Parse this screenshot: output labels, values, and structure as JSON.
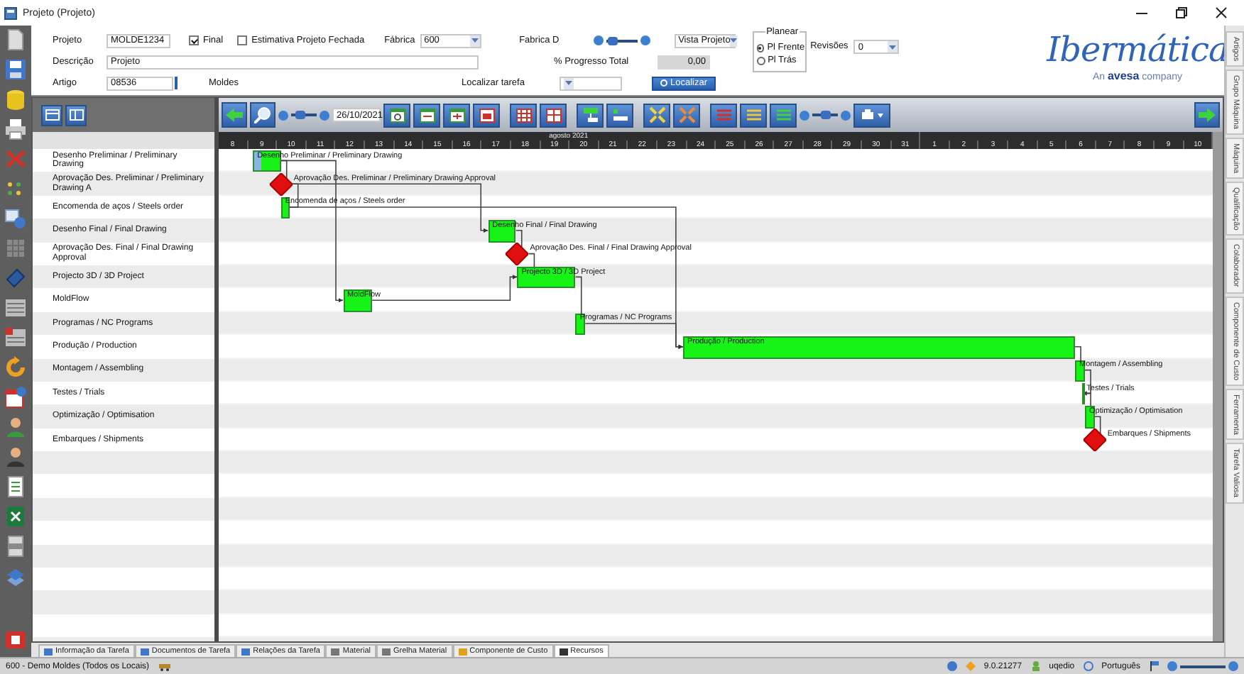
{
  "window": {
    "title": "Projeto (Projeto)"
  },
  "form": {
    "project": {
      "label": "Projeto",
      "value": "MOLDE1234"
    },
    "final": {
      "label": "Final",
      "checked": true
    },
    "estimate_closed": {
      "label": "Estimativa Projeto Fechada",
      "checked": false
    },
    "factory": {
      "label": "Fábrica",
      "value": "600"
    },
    "factory_name": "Fabrica D",
    "zoom": {
      "level": 0.2
    },
    "view": {
      "value": "Vista Projeto"
    },
    "plan": {
      "title": "Planear",
      "options": [
        {
          "label": "Pl Frente",
          "selected": true
        },
        {
          "label": "Pl Trás",
          "selected": false
        }
      ]
    },
    "revisions": {
      "label": "Revisões",
      "value": "0"
    },
    "description": {
      "label": "Descrição",
      "value": "Projeto"
    },
    "progress_total": {
      "label": "% Progresso Total",
      "value": "0,00"
    },
    "article": {
      "label": "Artigo",
      "value": "08536"
    },
    "article_type": "Moldes",
    "find_task": {
      "label": "Localizar tarefa",
      "button": "Localizar"
    }
  },
  "logo": {
    "name": "Ibermática",
    "tagline": "An **avesa** company"
  },
  "toolbar": {
    "zoom": {
      "level": 0.35
    },
    "date": "26/10/2021",
    "row_zoom": {
      "level": 0.5
    }
  },
  "timeline": {
    "months": [
      {
        "label": "agosto 2021",
        "days": [
          "8",
          "9",
          "10",
          "11",
          "12",
          "13",
          "14",
          "15",
          "16",
          "17",
          "18",
          "19",
          "20",
          "21",
          "22",
          "23",
          "24",
          "25",
          "26",
          "27",
          "28",
          "29",
          "30",
          "31"
        ]
      },
      {
        "days": [
          "1",
          "2",
          "3",
          "4",
          "5",
          "6",
          "7",
          "8",
          "9",
          "10"
        ]
      }
    ]
  },
  "tasks": [
    {
      "name": "Desenho Preliminar / Preliminary Drawing",
      "bar_label": "Desenho Preliminar / Preliminary Drawing",
      "kind": "task",
      "level": 0.25
    },
    {
      "name": "Aprovação Des. Preliminar / Preliminary Drawing A",
      "bar_label": "Aprovação Des. Preliminar / Preliminary Drawing Approval",
      "kind": "milestone"
    },
    {
      "name": "Encomenda de aços / Steels order",
      "bar_label": "Encomenda de aços / Steels order",
      "kind": "task"
    },
    {
      "name": "Desenho Final / Final Drawing",
      "bar_label": "Desenho Final / Final Drawing",
      "kind": "task"
    },
    {
      "name": "Aprovação Des. Final / Final Drawing Approval",
      "bar_label": "Aprovação Des. Final / Final Drawing Approval",
      "kind": "milestone"
    },
    {
      "name": "Projecto 3D / 3D Project",
      "bar_label": "Projecto 3D / 3D Project",
      "kind": "task"
    },
    {
      "name": "MoldFlow",
      "bar_label": "MoldFlow",
      "kind": "task"
    },
    {
      "name": "Programas / NC Programs",
      "bar_label": "Programas / NC Programs",
      "kind": "task"
    },
    {
      "name": "Produção / Production",
      "bar_label": "Produção / Production",
      "kind": "task"
    },
    {
      "name": "Montagem / Assembling",
      "bar_label": "Montagem / Assembling",
      "kind": "task"
    },
    {
      "name": "Testes / Trials",
      "bar_label": "Testes / Trials",
      "kind": "task"
    },
    {
      "name": "Optimização / Optimisation",
      "bar_label": "Optimização / Optimisation",
      "kind": "task"
    },
    {
      "name": "Embarques / Shipments",
      "bar_label": "Embarques / Shipments",
      "kind": "milestone"
    }
  ],
  "bottom_tabs": [
    {
      "label": "Informação da Tarefa",
      "selected": false
    },
    {
      "label": "Documentos de Tarefa",
      "selected": false
    },
    {
      "label": "Relações da Tarefa",
      "selected": false
    },
    {
      "label": "Material",
      "selected": false
    },
    {
      "label": "Grelha Material",
      "selected": false
    },
    {
      "label": "Componente de Custo",
      "selected": false
    },
    {
      "label": "Recursos",
      "selected": true
    }
  ],
  "side_tabs": [
    "Artigos",
    "Grupo Máquina",
    "Máquina",
    "Qualificação",
    "Colaborador",
    "Componente de Custo",
    "Ferramenta",
    "Tarefa Valiosa"
  ],
  "status_bar": {
    "company": "600 - Demo Moldes (Todos os Locais)",
    "version": "9.0.21277",
    "user": "uqedio",
    "language": "Português"
  }
}
